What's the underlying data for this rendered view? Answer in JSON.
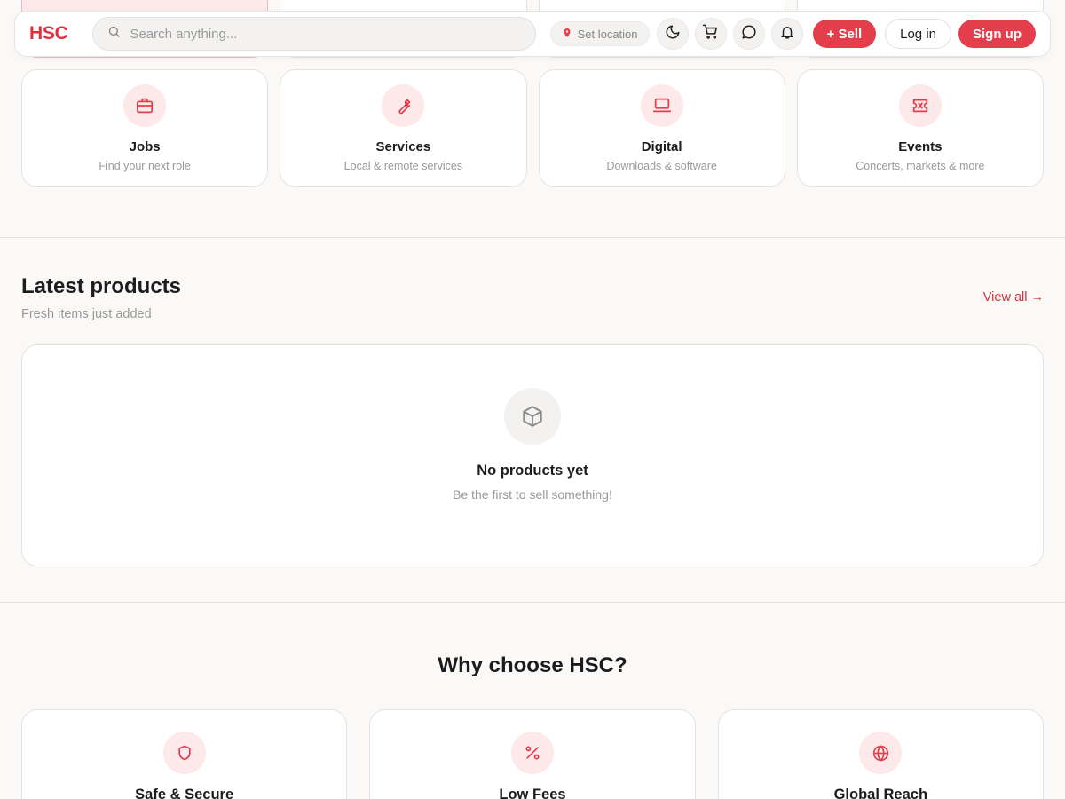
{
  "header": {
    "logo": "HSC",
    "search_placeholder": "Search anything...",
    "location_label": "Set location",
    "sell_label": "+ Sell",
    "login_label": "Log in",
    "signup_label": "Sign up"
  },
  "categories": [
    {
      "title": "Jobs",
      "subtitle": "Find your next role",
      "icon": "briefcase-icon"
    },
    {
      "title": "Services",
      "subtitle": "Local & remote services",
      "icon": "wrench-icon"
    },
    {
      "title": "Digital",
      "subtitle": "Downloads & software",
      "icon": "laptop-icon"
    },
    {
      "title": "Events",
      "subtitle": "Concerts, markets & more",
      "icon": "ticket-icon"
    }
  ],
  "latest": {
    "title": "Latest products",
    "subtitle": "Fresh items just added",
    "view_all": "View all →",
    "empty_title": "No products yet",
    "empty_subtitle": "Be the first to sell something!"
  },
  "why": {
    "title": "Why choose HSC?",
    "features": [
      {
        "title": "Safe & Secure",
        "icon": "shield-icon"
      },
      {
        "title": "Low Fees",
        "icon": "percent-icon"
      },
      {
        "title": "Global Reach",
        "icon": "globe-icon"
      }
    ]
  },
  "colors": {
    "accent": "#e43d4b",
    "accent_soft": "#fde9ea",
    "background": "#faf9f7"
  }
}
